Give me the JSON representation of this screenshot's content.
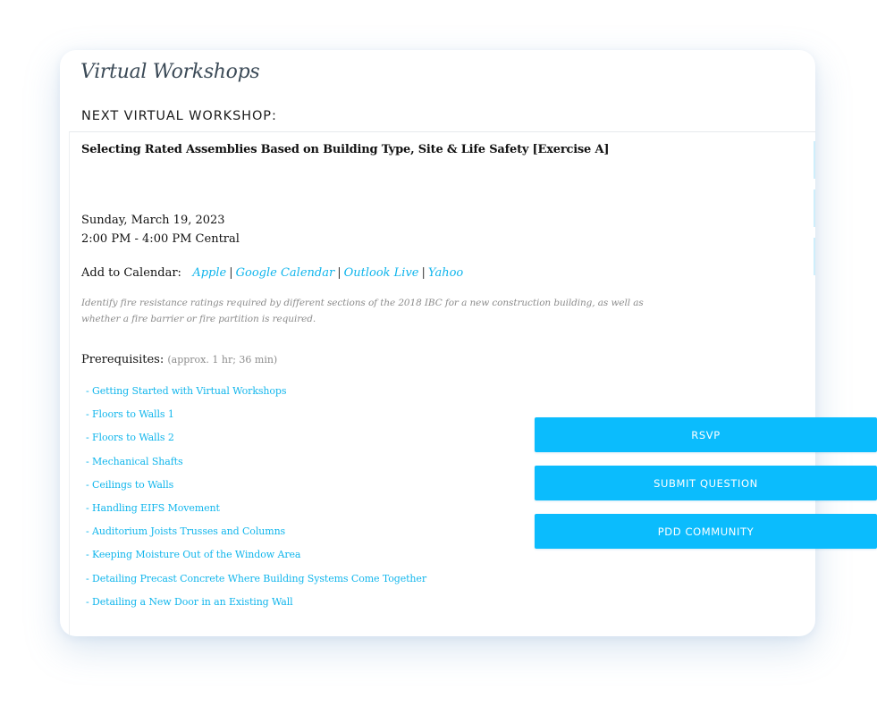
{
  "card": {
    "title": "Virtual Workshops",
    "section_label": "NEXT VIRTUAL WORKSHOP:"
  },
  "workshop": {
    "title": "Selecting Rated Assemblies Based on Building Type, Site & Life Safety [Exercise A]",
    "date": "Sunday, March 19, 2023",
    "time": "2:00 PM - 4:00 PM Central",
    "calendar_label": "Add to Calendar:",
    "calendar_links": [
      "Apple",
      "Google Calendar",
      "Outlook Live",
      "Yahoo"
    ],
    "calendar_separator": "|",
    "description": "Identify fire resistance ratings required by different sections of the 2018 IBC for a new construction building, as well as whether a fire barrier or fire partition is required.",
    "prereq_label": "Prerequisites:",
    "prereq_duration": "(approx. 1 hr; 36 min)",
    "prerequisites": [
      "- Getting Started with Virtual Workshops",
      "- Floors to Walls 1",
      "- Floors to Walls 2",
      "- Mechanical Shafts",
      "- Ceilings to Walls",
      "- Handling EIFS Movement",
      "- Auditorium Joists Trusses and Columns",
      "- Keeping Moisture Out of the Window Area",
      "- Detailing Precast Concrete Where Building Systems Come Together",
      "- Detailing a New Door in an Existing Wall"
    ]
  },
  "buttons": {
    "rsvp": "RSVP",
    "submit_question": "SUBMIT QUESTION",
    "community": "PDD COMMUNITY"
  },
  "colors": {
    "accent": "#0bbcfd",
    "link": "#12b6ec",
    "muted_text": "#8c8c8c",
    "title_text": "#3b4a57"
  }
}
